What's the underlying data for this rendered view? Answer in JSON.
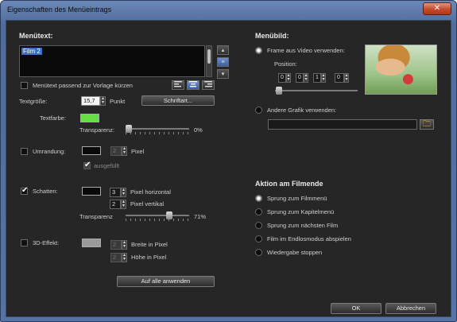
{
  "window": {
    "title": "Eigenschaften des Menüeintrags",
    "close_glyph": "✕"
  },
  "menutext": {
    "heading": "Menütext:",
    "value": "Film 2",
    "fit_label": "Menütext passend zur Vorlage kürzen",
    "size_label": "Textgröße:",
    "size_value": "15,7",
    "size_unit": "Punkt",
    "font_button": "Schriftart...",
    "color_label": "Textfarbe:",
    "text_color": "#66dd44",
    "transparency_label": "Transparenz:",
    "transparency_value": "0%",
    "transparency_fraction": 0.0
  },
  "outline": {
    "label": "Umrandung:",
    "color": "#0a0a0a",
    "width": "2",
    "unit": "Pixel",
    "filled_label": "ausgefüllt"
  },
  "shadow": {
    "label": "Schatten:",
    "checked": true,
    "color": "#0a0a0a",
    "horizontal": "3",
    "horizontal_label": "Pixel horizontal",
    "vertical": "2",
    "vertical_label": "Pixel vertikal",
    "transparency_label": "Transparenz",
    "transparency_value": "71%",
    "transparency_fraction": 0.71
  },
  "effect3d": {
    "label": "3D-Effekt:",
    "color": "#9a9a9a",
    "width": "2",
    "width_label": "Breite in Pixel",
    "height": "2",
    "height_label": "Höhe in Pixel"
  },
  "apply_all": "Auf alle anwenden",
  "menubild": {
    "heading": "Menübild:",
    "option_video": "Frame aus Video verwenden:",
    "position_label": "Position:",
    "timecode": [
      "0",
      "0",
      "1",
      "0"
    ],
    "option_graphic": "Andere Grafik verwenden:",
    "graphic_path": ""
  },
  "action": {
    "heading": "Aktion am Filmende",
    "options": [
      "Sprung zum Filmmenü",
      "Sprung zum Kapitelmenü",
      "Sprung zum nächsten Film",
      "Film im Endlosmodus abspielen",
      "Wiedergabe stoppen"
    ],
    "selected_index": 0
  },
  "buttons": {
    "ok": "OK",
    "cancel": "Abbrechen"
  },
  "icons": {
    "align_left": "align-left-icon",
    "align_center": "align-center-icon",
    "align_right": "align-right-icon",
    "folder": "folder-icon"
  }
}
